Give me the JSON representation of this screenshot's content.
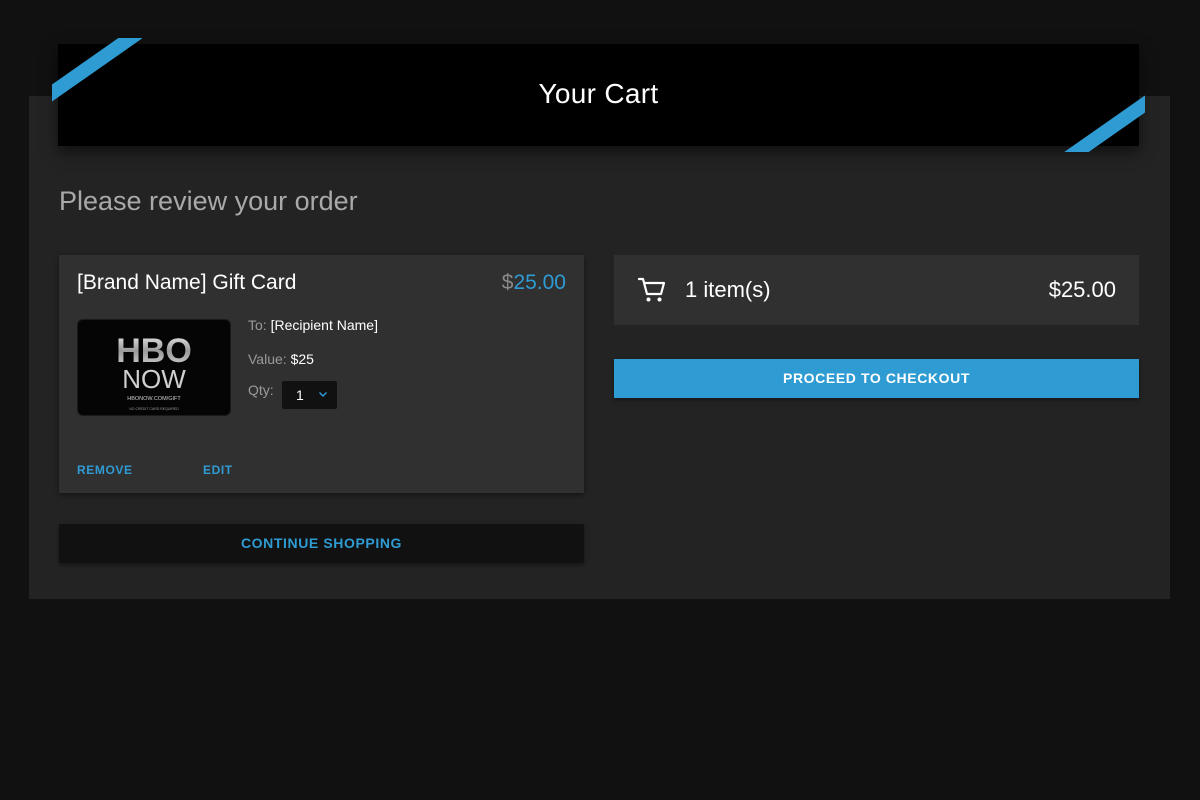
{
  "header": {
    "title": "Your Cart"
  },
  "review": {
    "heading": "Please review your order"
  },
  "item": {
    "title": "[Brand Name] Gift Card",
    "price_currency": "$",
    "price_amount": "25.00",
    "card_image": {
      "brand_top": "HBO",
      "brand_bottom": "NOW",
      "url_text": "HBONOW.COM/GIFT",
      "fine_print": "NO CREDIT CARD REQUIRED"
    },
    "to_label": "To:",
    "to_value": "[Recipient Name]",
    "value_label": "Value:",
    "value_value": "$25",
    "qty_label": "Qty:",
    "qty_value": "1",
    "remove_label": "REMOVE",
    "edit_label": "EDIT"
  },
  "continue_label": "CONTINUE SHOPPING",
  "summary": {
    "icon": "cart-icon",
    "count_label": "1 item(s)",
    "total": "$25.00"
  },
  "checkout_label": "PROCEED TO CHECKOUT",
  "colors": {
    "accent": "#2f9bd3",
    "background": "#111111",
    "panel": "#232323",
    "card": "#303030"
  }
}
